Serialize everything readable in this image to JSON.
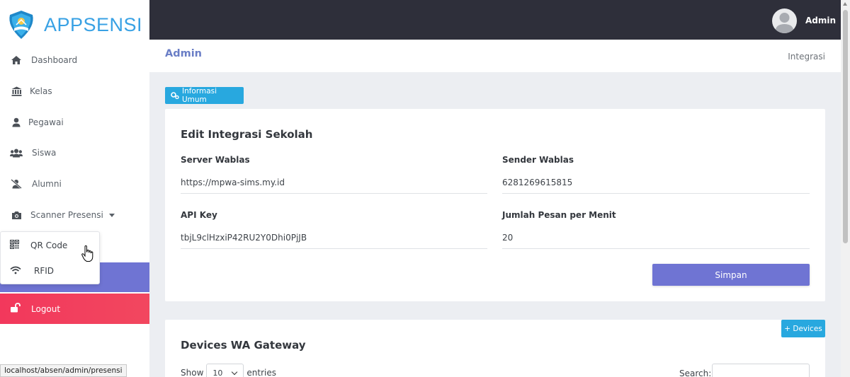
{
  "brand": {
    "name": "APPSENSI"
  },
  "sidebar": {
    "items": [
      {
        "label": "Dashboard",
        "icon": "home-icon"
      },
      {
        "label": "Kelas",
        "icon": "bank-icon"
      },
      {
        "label": "Pegawai",
        "icon": "user-icon"
      },
      {
        "label": "Siswa",
        "icon": "users-icon"
      },
      {
        "label": "Alumni",
        "icon": "user-slash-icon"
      },
      {
        "label": "Scanner Presensi",
        "icon": "camera-icon"
      }
    ],
    "dropdown": [
      {
        "label": "QR Code",
        "icon": "qrcode-icon"
      },
      {
        "label": "RFID",
        "icon": "wifi-icon"
      }
    ],
    "logout": "Logout"
  },
  "statusbar": {
    "url": "localhost/absen/admin/presensi"
  },
  "topbar": {
    "user": "Admin"
  },
  "header": {
    "title": "Admin",
    "breadcrumb": "Integrasi"
  },
  "info_button": "Informasi Umum",
  "form": {
    "title": "Edit Integrasi Sekolah",
    "server_label": "Server Wablas",
    "server_value": "https://mpwa-sims.my.id",
    "sender_label": "Sender Wablas",
    "sender_value": "6281269615815",
    "api_label": "API Key",
    "api_value": "tbjL9clHzxiP42RU2Y0Dhi0PjJB",
    "rate_label": "Jumlah Pesan per Menit",
    "rate_value": "20",
    "save": "Simpan"
  },
  "devices": {
    "title": "Devices WA Gateway",
    "add": "+ Devices",
    "show": "Show",
    "entries_value": "10",
    "entries": "entries",
    "search": "Search:"
  },
  "colors": {
    "accent": "#6f74d3",
    "info": "#28a8df",
    "danger": "#f2385c",
    "topbar": "#2e2f3a"
  }
}
